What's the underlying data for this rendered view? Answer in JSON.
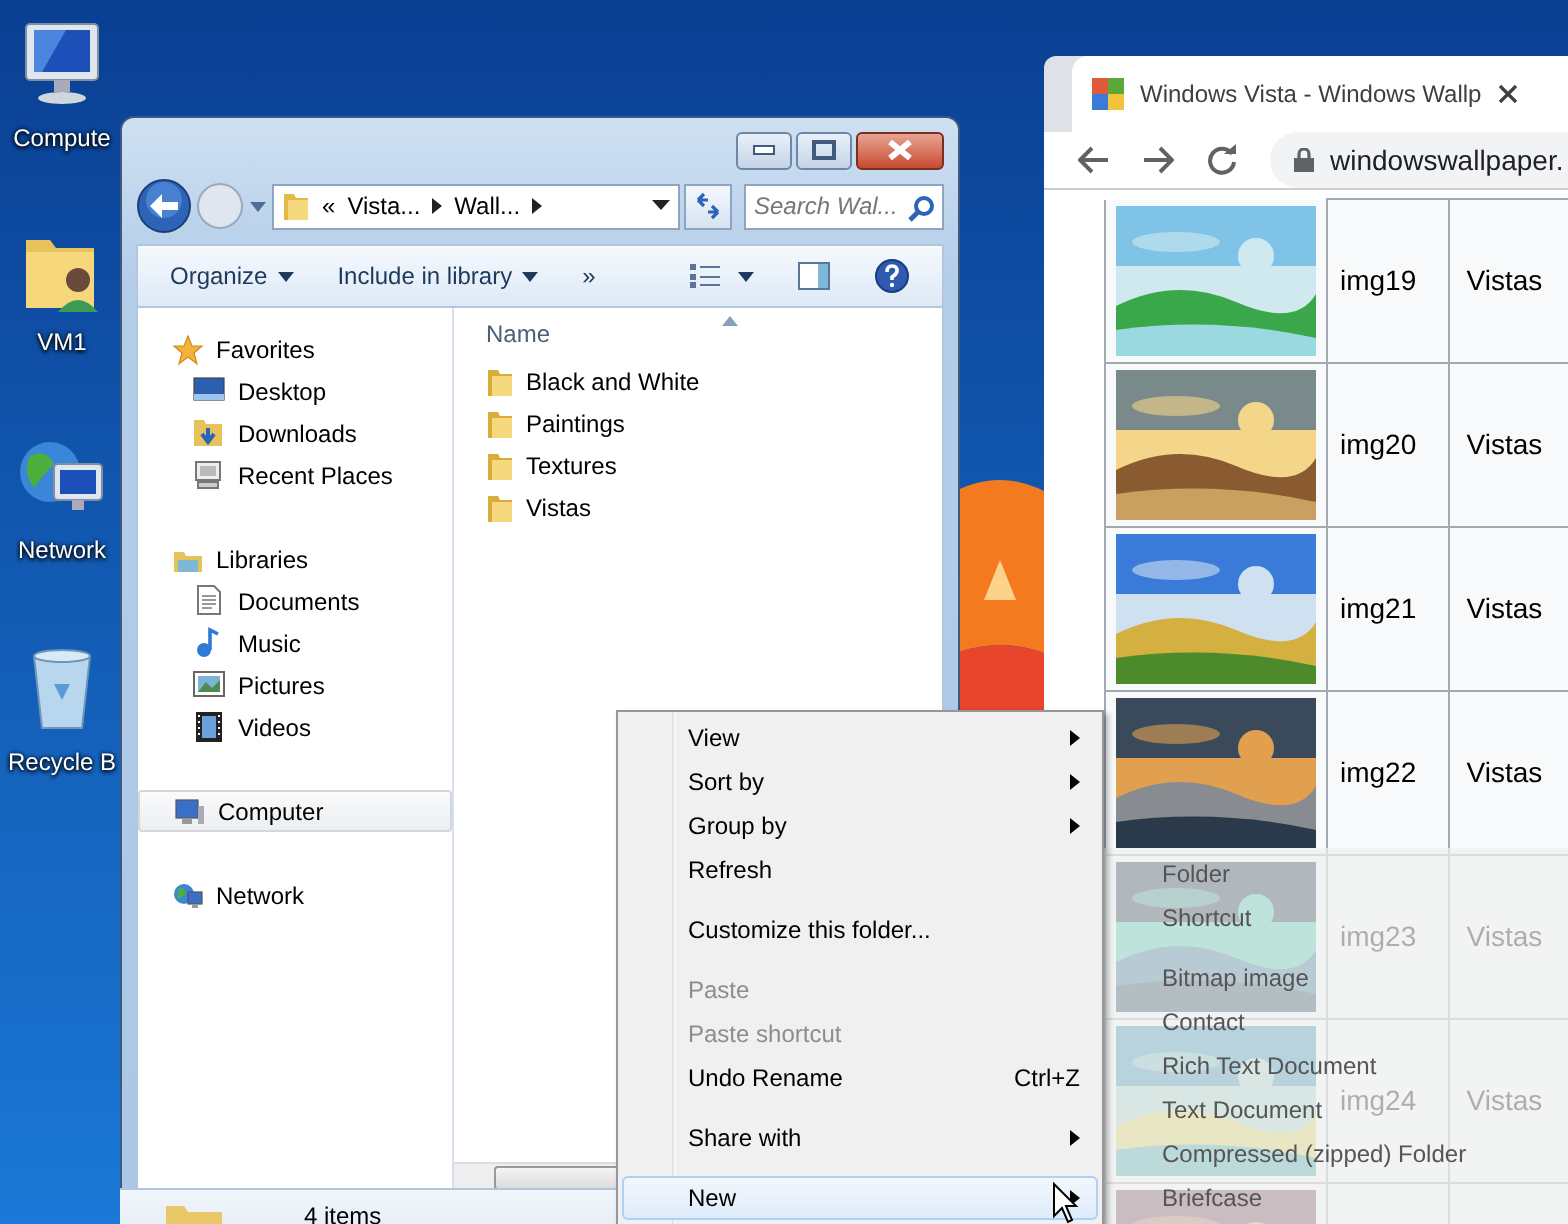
{
  "desktop": {
    "icons": [
      {
        "label": "Compute"
      },
      {
        "label": "VM1"
      },
      {
        "label": "Network"
      },
      {
        "label": "Recycle B"
      }
    ]
  },
  "explorer": {
    "address": {
      "overflow": "«",
      "segments": [
        "Vista...",
        "Wall..."
      ]
    },
    "search": {
      "placeholder": "Search Wal..."
    },
    "toolbar": [
      {
        "label": "Organize",
        "dropdown": true
      },
      {
        "label": "Include in library",
        "dropdown": true
      },
      {
        "label": "»",
        "dropdown": false
      }
    ],
    "nav_groups": [
      {
        "label": "Favorites",
        "selected": false,
        "children": [
          {
            "label": "Desktop",
            "selected": false
          },
          {
            "label": "Downloads",
            "selected": false
          },
          {
            "label": "Recent Places",
            "selected": false
          }
        ]
      },
      {
        "label": "Libraries",
        "selected": false,
        "children": [
          {
            "label": "Documents",
            "selected": false
          },
          {
            "label": "Music",
            "selected": false
          },
          {
            "label": "Pictures",
            "selected": false
          },
          {
            "label": "Videos",
            "selected": false
          }
        ]
      },
      {
        "label": "Computer",
        "selected": true
      },
      {
        "label": "Network",
        "selected": false
      }
    ],
    "column_header": "Name",
    "folders": [
      "Black and White",
      "Paintings",
      "Textures",
      "Vistas"
    ],
    "status": "4 items"
  },
  "browser": {
    "tab": {
      "title": "Windows Vista - Windows Wallp"
    },
    "url": "windowswallpaper.",
    "rows": [
      {
        "image": {
          "kind": "picture"
        },
        "name": "img19",
        "category": "Vistas"
      },
      {
        "image": {
          "kind": "picture"
        },
        "name": "img20",
        "category": "Vistas"
      },
      {
        "image": {
          "kind": "picture"
        },
        "name": "img21",
        "category": "Vistas"
      },
      {
        "image": {
          "kind": "picture"
        },
        "name": "img22",
        "category": "Vistas"
      },
      {
        "image": {
          "kind": "picture"
        },
        "name": "img23",
        "category": "Vistas"
      },
      {
        "image": {
          "kind": "picture"
        },
        "name": "img24",
        "category": "Vistas"
      },
      {
        "image": {
          "kind": "picture"
        }
      }
    ]
  },
  "context_menu": {
    "items": [
      {
        "kind": "item",
        "label": "View",
        "submenu": true,
        "disabled": false,
        "selected": false
      },
      {
        "kind": "item",
        "label": "Sort by",
        "submenu": true,
        "disabled": false,
        "selected": false
      },
      {
        "kind": "item",
        "label": "Group by",
        "submenu": true,
        "disabled": false,
        "selected": false
      },
      {
        "kind": "item",
        "label": "Refresh",
        "submenu": false,
        "disabled": false,
        "selected": false
      },
      {
        "kind": "separator"
      },
      {
        "kind": "item",
        "label": "Customize this folder...",
        "submenu": false,
        "disabled": false,
        "selected": false
      },
      {
        "kind": "separator"
      },
      {
        "kind": "item",
        "label": "Paste",
        "submenu": false,
        "disabled": true,
        "selected": false
      },
      {
        "kind": "item",
        "label": "Paste shortcut",
        "submenu": false,
        "disabled": true,
        "selected": false
      },
      {
        "kind": "item",
        "label": "Undo Rename",
        "shortcut": "Ctrl+Z",
        "submenu": false,
        "disabled": false,
        "selected": false
      },
      {
        "kind": "separator"
      },
      {
        "kind": "item",
        "label": "Share with",
        "submenu": true,
        "disabled": false,
        "selected": false
      },
      {
        "kind": "separator"
      },
      {
        "kind": "item",
        "label": "New",
        "submenu": true,
        "disabled": false,
        "selected": true
      }
    ]
  },
  "new_submenu": {
    "items": [
      {
        "kind": "item",
        "label": "Folder"
      },
      {
        "kind": "item",
        "label": "Shortcut"
      },
      {
        "kind": "separator"
      },
      {
        "kind": "item",
        "label": "Bitmap image"
      },
      {
        "kind": "item",
        "label": "Contact"
      },
      {
        "kind": "item",
        "label": "Rich Text Document"
      },
      {
        "kind": "item",
        "label": "Text Document"
      },
      {
        "kind": "item",
        "label": "Compressed (zipped) Folder"
      },
      {
        "kind": "item",
        "label": "Briefcase"
      }
    ]
  }
}
